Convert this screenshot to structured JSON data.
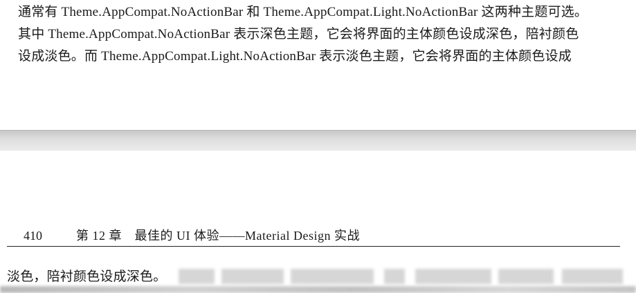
{
  "upper_page": {
    "lines": [
      "通常有 Theme.AppCompat.NoActionBar 和 Theme.AppCompat.Light.NoActionBar 这两种主题可选。",
      "其中 Theme.AppCompat.NoActionBar 表示深色主题，它会将界面的主体颜色设成深色，陪衬颜色",
      "设成淡色。而 Theme.AppCompat.Light.NoActionBar 表示淡色主题，它会将界面的主体颜色设成"
    ]
  },
  "lower_page": {
    "page_number": "410",
    "chapter_header": "第 12 章　最佳的 UI 体验——Material Design 实战",
    "first_line": "淡色，陪衬颜色设成深色。"
  }
}
